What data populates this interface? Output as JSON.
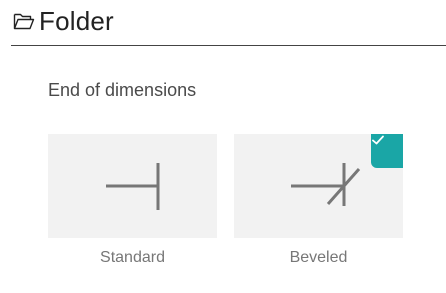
{
  "header": {
    "icon": "folder-open-icon",
    "title": "Folder"
  },
  "section": {
    "title": "End of dimensions"
  },
  "options": [
    {
      "label": "Standard",
      "icon": "standard-end-icon",
      "selected": false
    },
    {
      "label": "Beveled",
      "icon": "beveled-end-icon",
      "selected": true
    }
  ],
  "colors": {
    "accent": "#1aa6a6",
    "tile_background": "#f2f2f2",
    "line": "#777777"
  }
}
